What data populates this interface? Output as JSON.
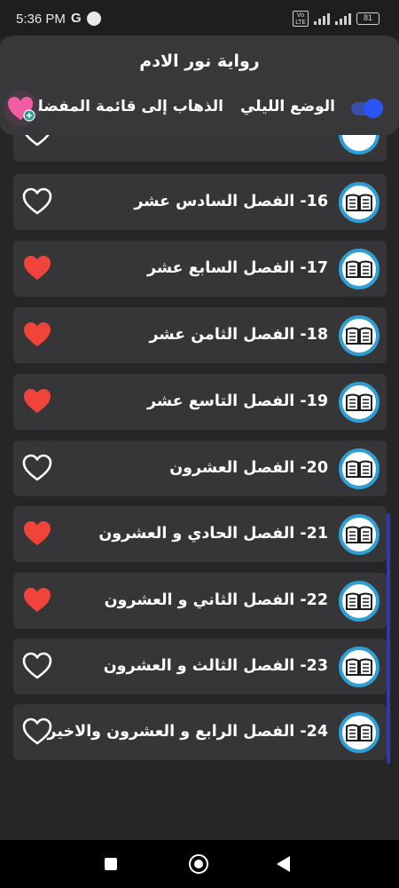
{
  "status_bar": {
    "time": "5:36 PM",
    "carrier_glyph": "G",
    "volte": "Vo LTE",
    "battery": "81"
  },
  "header": {
    "title": "رواية نور الادم",
    "night_mode_label": "الوضع الليلي",
    "night_mode_on": true,
    "favorites_label": "الذهاب إلى قائمة المفضلة"
  },
  "chapters": [
    {
      "title": "16- الفصل السادس عشر",
      "favorite": false
    },
    {
      "title": "17- الفصل السابع عشر",
      "favorite": true
    },
    {
      "title": "18- الفصل الثامن عشر",
      "favorite": true
    },
    {
      "title": "19- الفصل التاسع عشر",
      "favorite": true
    },
    {
      "title": "20- الفصل العشرون",
      "favorite": false
    },
    {
      "title": "21- الفصل الحادي و العشرون",
      "favorite": true
    },
    {
      "title": "22- الفصل الثاني و العشرون",
      "favorite": true
    },
    {
      "title": "23- الفصل الثالث و العشرون",
      "favorite": false
    },
    {
      "title": "24- الفصل الرابع و العشرون والاخير",
      "favorite": false
    }
  ],
  "icons": {
    "book": "book-icon",
    "heart": "heart-icon",
    "favorites": "favorites-heart-icon"
  },
  "colors": {
    "background": "#262528",
    "card": "#363538",
    "heart_filled": "#f0433a",
    "accent_blue": "#2a55f5",
    "book_ring": "#2f9ed4"
  }
}
